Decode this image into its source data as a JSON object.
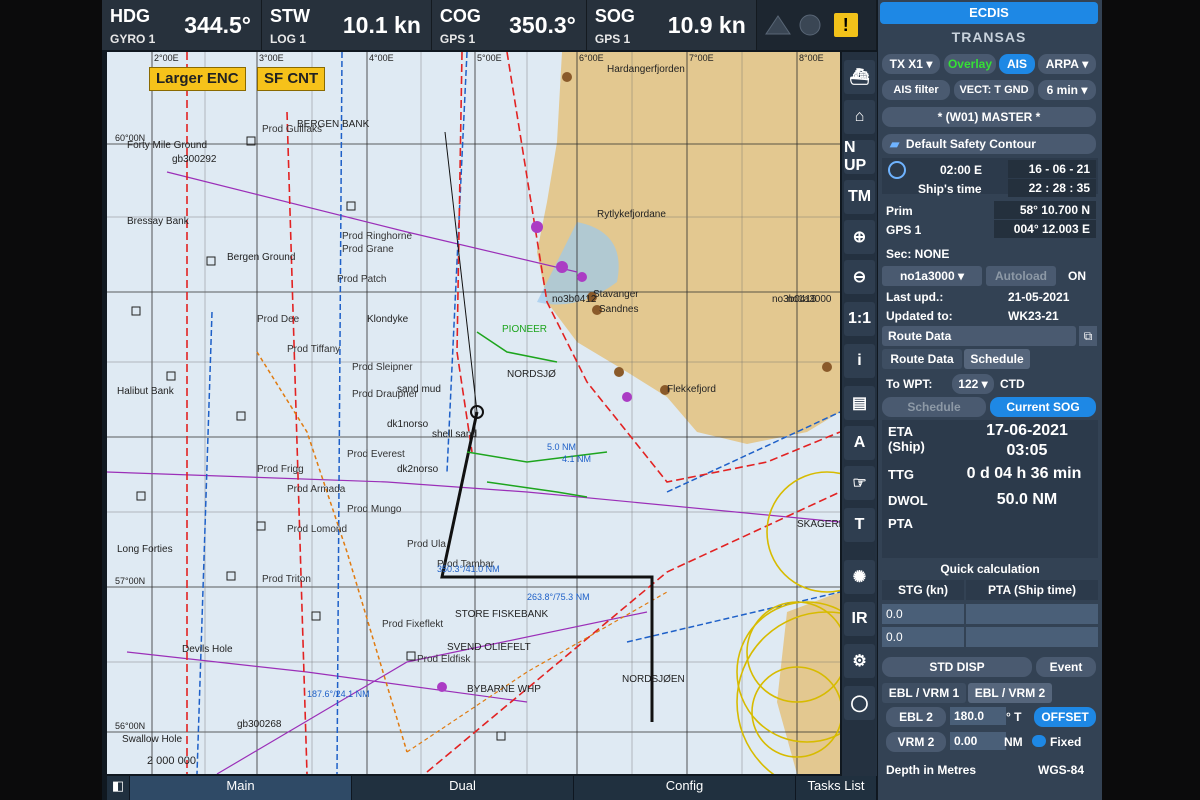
{
  "top_bar": {
    "hdg": {
      "label": "HDG",
      "source": "GYRO 1",
      "value": "344.5°"
    },
    "stw": {
      "label": "STW",
      "source": "LOG 1",
      "value": "10.1 kn"
    },
    "cog": {
      "label": "COG",
      "source": "GPS 1",
      "value": "350.3°"
    },
    "sog": {
      "label": "SOG",
      "source": "GPS 1",
      "value": "10.9 kn"
    },
    "alarm_icon": "warning-triangle-icon",
    "alarm_text": "!"
  },
  "chart": {
    "buttons": {
      "larger_enc": "Larger ENC",
      "sf_cnt": "SF CNT"
    },
    "lat_labels": [
      "60°00N",
      "57°00N",
      "56°00N"
    ],
    "lon_labels": [
      "2°00E",
      "3°00E",
      "4°00E",
      "5°00E",
      "6°00E",
      "7°00E",
      "8°00E"
    ],
    "place_names": [
      "BERGEN BANK",
      "Bressay Bank",
      "Bergen Ground",
      "Forty Mile Ground",
      "Sandnes",
      "Stavanger",
      "Flekkefjord",
      "NORDSJØ",
      "STORE FISKEBANK",
      "NORDSJØEN",
      "SKAGERRAK",
      "Halibut Bank",
      "Long Forties",
      "Devils Hole",
      "Swallow Hole",
      "sand mud",
      "shell sand",
      "dk1norso",
      "dk2norso",
      "no1a3000",
      "no3b0412",
      "no3b0416",
      "gb300292",
      "gb300268",
      "Prod Draupner",
      "Prod Gullfaks",
      "Prod Frigg",
      "Prod Eldfisk",
      "Prod Ula",
      "Prod Triton",
      "PIONEER",
      "Rytlykefjordane",
      "Klondyke",
      "Prod Tambar",
      "Prod Fixeflekt",
      "Prod Sleipner",
      "Prod Everest",
      "Prod Armada",
      "Prod Lomond",
      "Prod Mungo",
      "Prod Ringhorne",
      "Prod Grane",
      "Prod Tiffany",
      "Prod Dee",
      "Prod Patch",
      "SVEND OLIEFELT",
      "BYBARNE WHP",
      "Hardangerfjorden"
    ],
    "depth_labels": [
      "2 000 000"
    ],
    "route_legs": [
      "350.3°/41.0 NM",
      "263.8°/75.3 NM",
      "187.6°/24.1 NM",
      "5.0 NM",
      "4.1 NM"
    ]
  },
  "toolbar": {
    "items": [
      {
        "name": "ship-icon-btn",
        "icon": "ship-icon",
        "label": ""
      },
      {
        "name": "home-ship-btn",
        "icon": "home-icon",
        "label": ""
      },
      {
        "name": "north-up-btn",
        "icon": "",
        "label": "N UP"
      },
      {
        "name": "tm-btn",
        "icon": "",
        "label": "TM"
      },
      {
        "name": "zoom-in-btn",
        "icon": "zoom-in-icon",
        "label": "⊕"
      },
      {
        "name": "zoom-out-btn",
        "icon": "zoom-out-icon",
        "label": "⊖"
      },
      {
        "name": "scale-btn",
        "icon": "",
        "label": "1:1"
      },
      {
        "name": "info-btn",
        "icon": "info-icon",
        "label": "i"
      },
      {
        "name": "page-btn",
        "icon": "document-icon",
        "label": "▤"
      },
      {
        "name": "text-btn",
        "icon": "text-icon",
        "label": "A"
      },
      {
        "name": "drag-btn",
        "icon": "hand-icon",
        "label": "☞"
      },
      {
        "name": "target-btn",
        "icon": "target-icon",
        "label": "T"
      },
      {
        "name": "day-night-btn",
        "icon": "sun-icon",
        "label": "✺"
      },
      {
        "name": "ir-btn",
        "icon": "",
        "label": "IR"
      },
      {
        "name": "settings-btn",
        "icon": "gear-icon",
        "label": "⚙"
      },
      {
        "name": "power-btn",
        "icon": "power-icon",
        "label": "◯"
      }
    ]
  },
  "panel": {
    "title": "ECDIS",
    "brand": "TRANSAS",
    "tx": "TX X1",
    "overlay": "Overlay",
    "ais": "AIS",
    "arpa": "ARPA",
    "ais_filter": "AIS filter",
    "vect": "VECT: T GND",
    "vect_time": "6 min",
    "master": "* (W01) MASTER *",
    "safety_contour": "Default Safety Contour",
    "time_zone": "02:00 E",
    "date": "16 - 06 - 21",
    "ships_time_label": "Ship's time",
    "ships_time": "22 : 28 : 35",
    "prim_label": "Prim",
    "lat": "58° 10.700 N",
    "gps_label": "GPS 1",
    "lon": "004° 12.003 E",
    "sec": "Sec: NONE",
    "chart_cell": "no1a3000",
    "autoload": "Autoload",
    "autoload_state": "ON",
    "last_upd_label": "Last upd.:",
    "last_upd": "21-05-2021",
    "updated_to_label": "Updated to:",
    "updated_to": "WK23-21",
    "route_data": "Route Data",
    "tab_route": "Route Data",
    "tab_schedule": "Schedule",
    "to_wpt_label": "To WPT:",
    "to_wpt": "122",
    "ctd": "CTD",
    "schedule_btn": "Schedule",
    "current_sog": "Current SOG",
    "eta_label": "ETA (Ship)",
    "eta_date": "17-06-2021",
    "eta_time": "03:05",
    "ttg_label": "TTG",
    "ttg": "0 d 04 h 36 min",
    "dwol_label": "DWOL",
    "dwol": "50.0 NM",
    "pta_label": "PTA",
    "quick_calc": "Quick calculation",
    "stg_head": "STG (kn)",
    "pta_head": "PTA (Ship time)",
    "stg_row1": "0.0",
    "stg_row2": "0.0",
    "std_disp": "STD DISP",
    "event": "Event",
    "ebl_tab1": "EBL / VRM 1",
    "ebl_tab2": "EBL / VRM 2",
    "ebl2": "EBL 2",
    "ebl_val": "180.0",
    "ebl_unit": "° T",
    "offset": "OFFSET",
    "vrm2": "VRM 2",
    "vrm_val": "0.00",
    "vrm_unit": "NM",
    "fixed": "Fixed",
    "depth_units": "Depth in Metres",
    "datum": "WGS-84"
  },
  "tabs": [
    "Main",
    "Dual",
    "Config",
    "Tasks List"
  ],
  "colors": {
    "route": "#e22222",
    "track": "#111111",
    "land": "#e3c890",
    "water": "#dfeaf3",
    "accent": "#1e88e5"
  }
}
